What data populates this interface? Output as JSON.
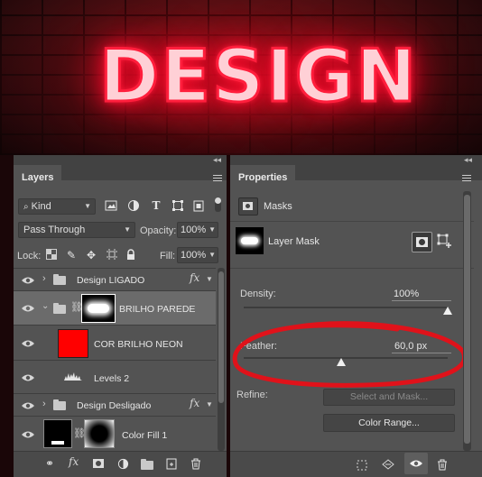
{
  "artwork": {
    "neon_text": "DESIGN",
    "glow_color": "#ff1e3c"
  },
  "layers_panel": {
    "tab_label": "Layers",
    "filter_kind": "Kind",
    "blend_mode": "Pass Through",
    "opacity_label": "Opacity:",
    "opacity_value": "100%",
    "lock_label": "Lock:",
    "fill_label": "Fill:",
    "fill_value": "100%",
    "layers": [
      {
        "name": "Design LIGADO",
        "type": "group",
        "fx": "fx"
      },
      {
        "name": "BRILHO PAREDE",
        "type": "group-with-mask",
        "selected": true
      },
      {
        "name": "COR BRILHO NEON",
        "type": "solid-color",
        "swatch": "#ff0000"
      },
      {
        "name": "Levels 2",
        "type": "adjustment"
      },
      {
        "name": "Design Desligado",
        "type": "group",
        "fx": "fx"
      },
      {
        "name": "Color Fill 1",
        "type": "fill-with-mask"
      }
    ],
    "footer_fx": "fx"
  },
  "properties_panel": {
    "tab_label": "Properties",
    "section_label": "Masks",
    "mask_type_label": "Layer Mask",
    "density_label": "Density:",
    "density_value": "100%",
    "density_fraction": 1.0,
    "feather_label": "Feather:",
    "feather_value": "60,0 px",
    "feather_fraction": 0.48,
    "refine_label": "Refine:",
    "select_and_mask_label": "Select and Mask...",
    "color_range_label": "Color Range..."
  },
  "annotation": {
    "color": "#e0121a"
  }
}
